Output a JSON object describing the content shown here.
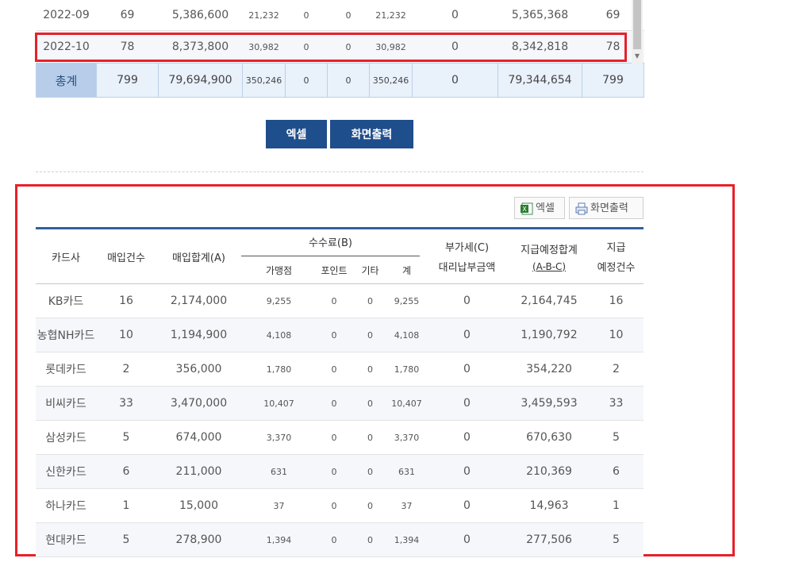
{
  "top_table": {
    "rows": [
      {
        "month": "2022-09",
        "count": "69",
        "purchase": "5,386,600",
        "merchant": "21,232",
        "point": "0",
        "etc": "0",
        "fee": "21,232",
        "vat": "0",
        "payout": "5,365,368",
        "payout_count": "69"
      },
      {
        "month": "2022-10",
        "count": "78",
        "purchase": "8,373,800",
        "merchant": "30,982",
        "point": "0",
        "etc": "0",
        "fee": "30,982",
        "vat": "0",
        "payout": "8,342,818",
        "payout_count": "78"
      }
    ],
    "total": {
      "label": "총계",
      "count": "799",
      "purchase": "79,694,900",
      "merchant": "350,246",
      "point": "0",
      "etc": "0",
      "fee": "350,246",
      "vat": "0",
      "payout": "79,344,654",
      "payout_count": "799"
    }
  },
  "buttons": {
    "excel": "엑셀",
    "print": "화면출력"
  },
  "small_buttons": {
    "excel": "엑셀",
    "print": "화면출력"
  },
  "bottom_table": {
    "headers": {
      "card": "카드사",
      "count": "매입건수",
      "purchase": "매입합계(A)",
      "fee_group": "수수료(B)",
      "merchant": "가맹점",
      "point": "포인트",
      "etc": "기타",
      "fee_total": "계",
      "vat_line1": "부가세(C)",
      "vat_line2": "대리납부금액",
      "payout_line1": "지급예정합계",
      "payout_line2": "(A-B-C)",
      "payout_count_line1": "지급",
      "payout_count_line2": "예정건수"
    },
    "rows": [
      {
        "card": "KB카드",
        "count": "16",
        "purchase": "2,174,000",
        "merchant": "9,255",
        "point": "0",
        "etc": "0",
        "fee": "9,255",
        "vat": "0",
        "payout": "2,164,745",
        "payout_count": "16"
      },
      {
        "card": "농협NH카드",
        "count": "10",
        "purchase": "1,194,900",
        "merchant": "4,108",
        "point": "0",
        "etc": "0",
        "fee": "4,108",
        "vat": "0",
        "payout": "1,190,792",
        "payout_count": "10"
      },
      {
        "card": "롯데카드",
        "count": "2",
        "purchase": "356,000",
        "merchant": "1,780",
        "point": "0",
        "etc": "0",
        "fee": "1,780",
        "vat": "0",
        "payout": "354,220",
        "payout_count": "2"
      },
      {
        "card": "비씨카드",
        "count": "33",
        "purchase": "3,470,000",
        "merchant": "10,407",
        "point": "0",
        "etc": "0",
        "fee": "10,407",
        "vat": "0",
        "payout": "3,459,593",
        "payout_count": "33"
      },
      {
        "card": "삼성카드",
        "count": "5",
        "purchase": "674,000",
        "merchant": "3,370",
        "point": "0",
        "etc": "0",
        "fee": "3,370",
        "vat": "0",
        "payout": "670,630",
        "payout_count": "5"
      },
      {
        "card": "신한카드",
        "count": "6",
        "purchase": "211,000",
        "merchant": "631",
        "point": "0",
        "etc": "0",
        "fee": "631",
        "vat": "0",
        "payout": "210,369",
        "payout_count": "6"
      },
      {
        "card": "하나카드",
        "count": "1",
        "purchase": "15,000",
        "merchant": "37",
        "point": "0",
        "etc": "0",
        "fee": "37",
        "vat": "0",
        "payout": "14,963",
        "payout_count": "1"
      },
      {
        "card": "현대카드",
        "count": "5",
        "purchase": "278,900",
        "merchant": "1,394",
        "point": "0",
        "etc": "0",
        "fee": "1,394",
        "vat": "0",
        "payout": "277,506",
        "payout_count": "5"
      }
    ]
  },
  "colors": {
    "highlight": "#e8202a",
    "primary": "#1f4e8c",
    "total_bg": "#b7cde9"
  }
}
